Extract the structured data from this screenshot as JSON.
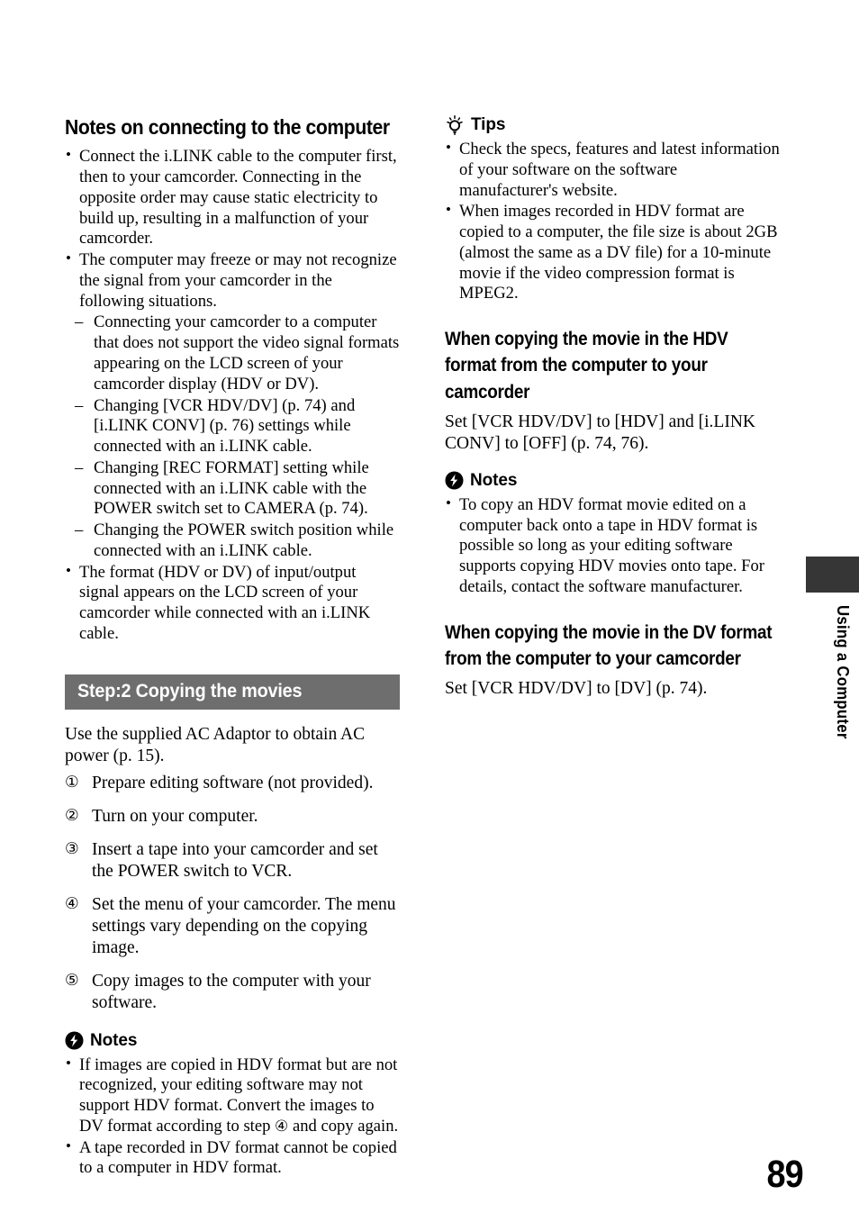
{
  "page": {
    "number": "89",
    "chapter_tab": "Using a Computer"
  },
  "left_column": {
    "heading": "Notes on connecting to the computer",
    "bullets": [
      "Connect the i.LINK cable to the computer first, then to your camcorder. Connecting in the opposite order may cause static electricity to build up, resulting in a malfunction of your camcorder.",
      "The computer may freeze or may not recognize the signal from your camcorder in the following situations."
    ],
    "sub_bullets": [
      "Connecting your camcorder to a computer that does not support the video signal formats appearing on the LCD screen of your camcorder display (HDV or DV).",
      "Changing [VCR HDV/DV] (p. 74) and [i.LINK CONV] (p. 76) settings while connected with an i.LINK cable.",
      "Changing [REC FORMAT] setting while connected with an i.LINK cable with the POWER switch set to CAMERA (p. 74).",
      "Changing the POWER switch position while connected with an i.LINK cable."
    ],
    "bullet_last": "The format (HDV or DV) of input/output signal appears on the LCD screen of your camcorder while connected with an i.LINK cable.",
    "banner_title": "Step:2 Copying the movies",
    "intro": "Use the supplied AC Adaptor to obtain AC power (p. 15).",
    "steps": [
      {
        "num": "①",
        "text": "Prepare editing software (not provided)."
      },
      {
        "num": "②",
        "text": "Turn on your computer."
      },
      {
        "num": "③",
        "text": "Insert a tape into your camcorder and set the POWER switch to VCR."
      },
      {
        "num": "④",
        "text": "Set the menu of your camcorder. The menu settings vary depending on the copying image."
      },
      {
        "num": "⑤",
        "text": "Copy images to the computer with your software."
      }
    ],
    "notes_label": "Notes",
    "notes": [
      {
        "prefix": "If images are copied in HDV format but are not recognized, your editing software may not support HDV format. Convert the images to DV format according to step ",
        "inline_num": "④",
        "suffix": " and copy again."
      },
      {
        "prefix": "A tape recorded in DV format cannot be copied to a computer in HDV format.",
        "inline_num": "",
        "suffix": ""
      }
    ]
  },
  "right_column": {
    "tips_label": "Tips",
    "tips": [
      "Check the specs, features and latest information of your software on the software manufacturer's website.",
      "When images recorded in HDV format are copied to a computer, the file size is about 2GB (almost the same as a DV file) for a 10-minute movie if the video compression format is MPEG2."
    ],
    "hdv_heading": "When copying the movie in the HDV format from the computer to your camcorder",
    "hdv_body": "Set [VCR HDV/DV] to [HDV] and [i.LINK CONV] to [OFF] (p. 74, 76).",
    "notes_label": "Notes",
    "hdv_notes": [
      "To copy an HDV format movie edited on a computer back onto a tape in HDV format is possible so long as your editing software supports copying HDV movies onto tape. For details, contact the software manufacturer."
    ],
    "dv_heading": "When copying the movie in the DV format from the computer to your camcorder",
    "dv_body": "Set [VCR HDV/DV] to [DV] (p. 74)."
  },
  "icons": {
    "notes": "notes-lightning-icon",
    "tips": "tips-lightbulb-icon"
  },
  "colors": {
    "banner_gray": "#6e6e6e",
    "tab_dark": "#363636",
    "text": "#000000"
  }
}
